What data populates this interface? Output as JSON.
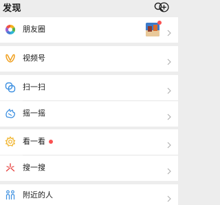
{
  "header": {
    "title": "发现",
    "search_icon": "search-icon",
    "add_icon": "plus-circle-icon"
  },
  "rows": [
    {
      "id": "moments",
      "label": "朋友圈",
      "icon": "moments-icon",
      "badge": "thumbnail-with-red-dot"
    },
    {
      "id": "channels",
      "label": "视频号",
      "icon": "channels-icon"
    },
    {
      "id": "scan",
      "label": "扫一扫",
      "icon": "scan-icon"
    },
    {
      "id": "shake",
      "label": "摇一摇",
      "icon": "shake-icon"
    },
    {
      "id": "top-stories",
      "label": "看一看",
      "icon": "top-stories-icon",
      "badge": "red-dot"
    },
    {
      "id": "search",
      "label": "搜一搜",
      "icon": "search-sparkle-icon"
    },
    {
      "id": "nearby",
      "label": "附近的人",
      "icon": "people-nearby-icon"
    }
  ],
  "colors": {
    "background": "#ededed",
    "row": "#ffffff",
    "badge_red": "#fa5151",
    "chevron": "#b2b2b2"
  }
}
